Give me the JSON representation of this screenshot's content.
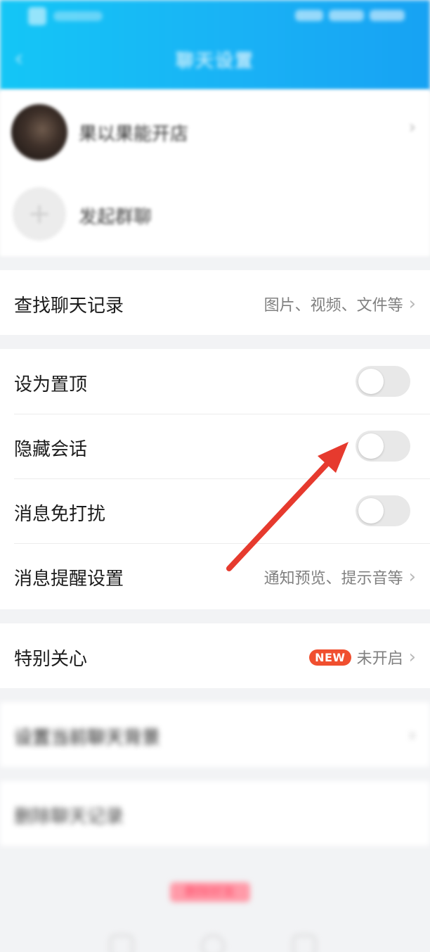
{
  "status_bar": {
    "time": "",
    "battery": ""
  },
  "nav": {
    "back_icon": "back-arrow-icon",
    "title": "聊天设置"
  },
  "contact": {
    "name": "果以果能开店"
  },
  "group_chat": {
    "label": "发起群聊",
    "icon": "plus-icon"
  },
  "search_history": {
    "label": "查找聊天记录",
    "hint": "图片、视频、文件等"
  },
  "pin_top": {
    "label": "设为置顶",
    "enabled": false
  },
  "hide_chat": {
    "label": "隐藏会话",
    "enabled": false
  },
  "do_not_disturb": {
    "label": "消息免打扰",
    "enabled": false
  },
  "notify_settings": {
    "label": "消息提醒设置",
    "hint": "通知预览、提示音等"
  },
  "special_care": {
    "label": "特别关心",
    "badge": "NEW",
    "status": "未开启"
  },
  "chat_background": {
    "label": "设置当前聊天背景"
  },
  "delete_history": {
    "label": "删除聊天记录"
  },
  "bottom_action": {
    "label": "删除好友"
  },
  "colors": {
    "header": "#17b0f5",
    "badge": "#f04f2f",
    "arrow": "#e63a2e",
    "toggle_off": "#e8e8e8"
  }
}
